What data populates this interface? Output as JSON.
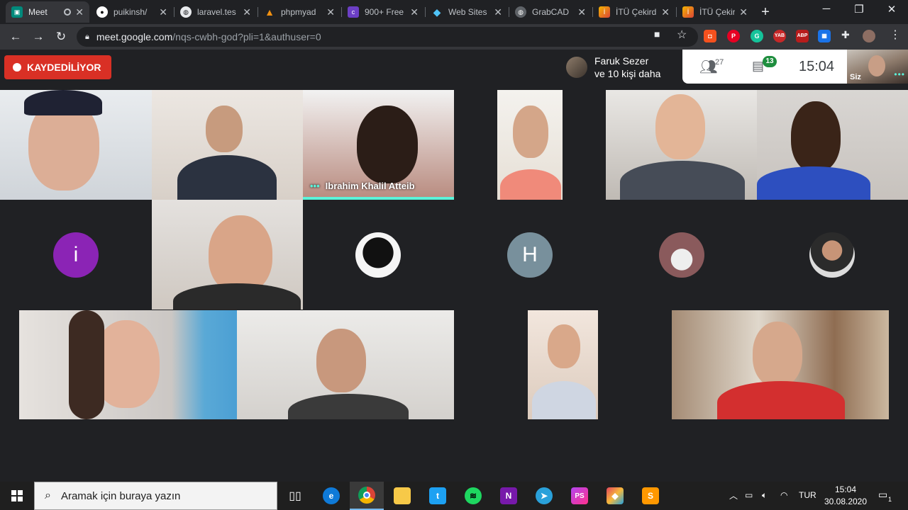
{
  "browser": {
    "tabs": [
      {
        "label": "Meet",
        "icon": "meet-icon",
        "active": true
      },
      {
        "label": "puikinsh/",
        "icon": "github-icon"
      },
      {
        "label": "laravel.tes",
        "icon": "globe-icon"
      },
      {
        "label": "phpmyad",
        "icon": "phpmyadmin-icon"
      },
      {
        "label": "900+ Free",
        "icon": "colorlib-icon"
      },
      {
        "label": "Web Sites",
        "icon": "websites-icon"
      },
      {
        "label": "GrabCAD",
        "icon": "globe-icon"
      },
      {
        "label": "İTÜ Çekird",
        "icon": "itu-icon"
      },
      {
        "label": "İTÜ Çekird",
        "icon": "itu-icon"
      }
    ],
    "url_host": "meet.google.com",
    "url_path": "/nqs-cwbh-god?pli=1&authuser=0"
  },
  "meet": {
    "recording_label": "KAYDEDİLİYOR",
    "presenter_line1": "Faruk Sezer",
    "presenter_line2": "ve 10 kişi daha",
    "participants_count": "27",
    "chat_count": "13",
    "time": "15:04",
    "self_label": "Siz",
    "speaker_name": "Ibrahim Khalil Atteib",
    "avatar_i": "i",
    "avatar_h": "H"
  },
  "taskbar": {
    "search_placeholder": "Aramak için buraya yazın",
    "language": "TUR",
    "time": "15:04",
    "date": "30.08.2020",
    "notification_count": "1"
  },
  "colors": {
    "accent_teal": "#5bf3d9",
    "record_red": "#d93025",
    "chat_badge_green": "#1e8e3e",
    "avatar_purple": "#8b24b5",
    "avatar_slate": "#78909c"
  }
}
